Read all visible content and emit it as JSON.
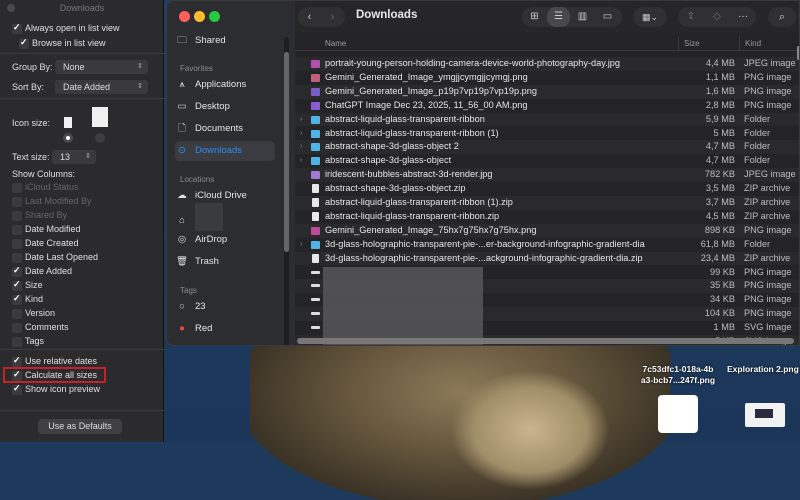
{
  "options_panel": {
    "title": "Downloads",
    "always_open_list": {
      "label": "Always open in list view",
      "checked": true
    },
    "browse_list": {
      "label": "Browse in list view",
      "checked": true
    },
    "group_by": {
      "label": "Group By:",
      "value": "None"
    },
    "sort_by": {
      "label": "Sort By:",
      "value": "Date Added"
    },
    "icon_size_label": "Icon size:",
    "text_size": {
      "label": "Text size:",
      "value": "13"
    },
    "show_columns_label": "Show Columns:",
    "columns": [
      {
        "label": "iCloud Status",
        "checked": false,
        "disabled": true
      },
      {
        "label": "Last Modified By",
        "checked": false,
        "disabled": true
      },
      {
        "label": "Shared By",
        "checked": false,
        "disabled": true
      },
      {
        "label": "Date Modified",
        "checked": false
      },
      {
        "label": "Date Created",
        "checked": false
      },
      {
        "label": "Date Last Opened",
        "checked": false
      },
      {
        "label": "Date Added",
        "checked": true
      },
      {
        "label": "Size",
        "checked": true
      },
      {
        "label": "Kind",
        "checked": true
      },
      {
        "label": "Version",
        "checked": false
      },
      {
        "label": "Comments",
        "checked": false
      },
      {
        "label": "Tags",
        "checked": false
      }
    ],
    "options": [
      {
        "label": "Use relative dates",
        "checked": true
      },
      {
        "label": "Calculate all sizes",
        "checked": true,
        "highlighted": true
      },
      {
        "label": "Show icon preview",
        "checked": true
      }
    ],
    "defaults_button": "Use as Defaults"
  },
  "sidebar": {
    "top": {
      "label": "Shared",
      "icon": "shared-folder-icon"
    },
    "favorites_header": "Favorites",
    "favorites": [
      {
        "label": "Applications",
        "icon": "applications-icon"
      },
      {
        "label": "Desktop",
        "icon": "desktop-icon"
      },
      {
        "label": "Documents",
        "icon": "document-icon"
      },
      {
        "label": "Downloads",
        "icon": "downloads-icon",
        "active": true
      }
    ],
    "locations_header": "Locations",
    "locations": [
      {
        "label": "iCloud Drive",
        "icon": "cloud-icon"
      },
      {
        "label": "",
        "icon": "home-icon"
      },
      {
        "label": "AirDrop",
        "icon": "airdrop-icon"
      },
      {
        "label": "Trash",
        "icon": "trash-icon"
      }
    ],
    "tags_header": "Tags",
    "tags": [
      {
        "label": "23",
        "color": "none"
      },
      {
        "label": "Red",
        "color": "#ff453a"
      }
    ]
  },
  "toolbar": {
    "title": "Downloads"
  },
  "columns": {
    "name": "Name",
    "size": "Size",
    "kind": "Kind"
  },
  "files": [
    {
      "name": "portrait-young-person-holding-camera-device-world-photography-day.jpg",
      "size": "4,4 MB",
      "kind": "JPEG image",
      "type": "image",
      "color": "#b04fb0"
    },
    {
      "name": "Gemini_Generated_Image_ymgjjcymgjjcymgj.png",
      "size": "1,1 MB",
      "kind": "PNG image",
      "type": "image",
      "color": "#c0607a"
    },
    {
      "name": "Gemini_Generated_Image_p19p7vp19p7vp19p.png",
      "size": "1,6 MB",
      "kind": "PNG image",
      "type": "image",
      "color": "#7a5cc8"
    },
    {
      "name": "ChatGPT Image Dec 23, 2025, 11_56_00 AM.png",
      "size": "2,8 MB",
      "kind": "PNG image",
      "type": "image",
      "color": "#8a5cd0"
    },
    {
      "name": "abstract-liquid-glass-transparent-ribbon",
      "size": "5,9 MB",
      "kind": "Folder",
      "type": "folder"
    },
    {
      "name": "abstract-liquid-glass-transparent-ribbon (1)",
      "size": "5 MB",
      "kind": "Folder",
      "type": "folder"
    },
    {
      "name": "abstract-shape-3d-glass-object 2",
      "size": "4,7 MB",
      "kind": "Folder",
      "type": "folder"
    },
    {
      "name": "abstract-shape-3d-glass-object",
      "size": "4,7 MB",
      "kind": "Folder",
      "type": "folder"
    },
    {
      "name": "iridescent-bubbles-abstract-3d-render.jpg",
      "size": "782 KB",
      "kind": "JPEG image",
      "type": "image",
      "color": "#a07ad0"
    },
    {
      "name": "abstract-shape-3d-glass-object.zip",
      "size": "3,5 MB",
      "kind": "ZIP archive",
      "type": "doc"
    },
    {
      "name": "abstract-liquid-glass-transparent-ribbon (1).zip",
      "size": "3,7 MB",
      "kind": "ZIP archive",
      "type": "doc"
    },
    {
      "name": "abstract-liquid-glass-transparent-ribbon.zip",
      "size": "4,5 MB",
      "kind": "ZIP archive",
      "type": "doc"
    },
    {
      "name": "Gemini_Generated_Image_75hx7g75hx7g75hx.png",
      "size": "898 KB",
      "kind": "PNG image",
      "type": "image",
      "color": "#c04a9a"
    },
    {
      "name": "3d-glass-holographic-transparent-pie-...er-background-infographic-gradient-dia",
      "size": "61,8 MB",
      "kind": "Folder",
      "type": "folder"
    },
    {
      "name": "3d-glass-holographic-transparent-pie-...ackground-infographic-gradient-dia.zip",
      "size": "23,4 MB",
      "kind": "ZIP archive",
      "type": "doc"
    },
    {
      "name": "",
      "size": "99 KB",
      "kind": "PNG image",
      "type": "thin"
    },
    {
      "name": "",
      "size": "35 KB",
      "kind": "PNG image",
      "type": "thin"
    },
    {
      "name": "",
      "size": "34 KB",
      "kind": "PNG image",
      "type": "thin"
    },
    {
      "name": "",
      "size": "104 KB",
      "kind": "PNG image",
      "type": "thin"
    },
    {
      "name": "",
      "size": "1 MB",
      "kind": "SVG Image",
      "type": "thin"
    },
    {
      "name": "",
      "size": "5 KB",
      "kind": "SVG Image",
      "type": "thin"
    }
  ],
  "desktop": [
    {
      "label": "7c53dfc1-018a-4b\na3-bcb7...247f.png"
    },
    {
      "label": "Exploration 2.png"
    }
  ]
}
